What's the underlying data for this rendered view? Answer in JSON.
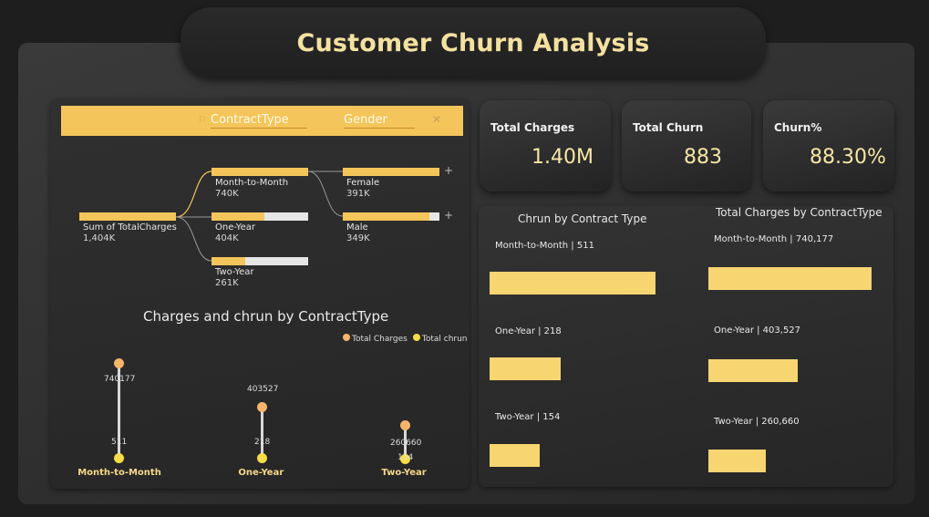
{
  "title": "Customer Churn Analysis",
  "colors": {
    "accent": "#f4c55a",
    "title": "#f4e1a0",
    "bar": "#f7d571",
    "charges_dot": "#f6b56b",
    "churn_dot": "#f7dd45"
  },
  "decomp_tree": {
    "header": {
      "level1": "ContractType",
      "level2": "Gender"
    },
    "root": {
      "label": "Sum of TotalCharges",
      "value": "1,404K"
    },
    "contract_nodes": [
      {
        "label": "Month-to-Month",
        "value": "740K",
        "fill": 1.0
      },
      {
        "label": "One-Year",
        "value": "404K",
        "fill": 0.545
      },
      {
        "label": "Two-Year",
        "value": "261K",
        "fill": 0.352
      }
    ],
    "gender_nodes": [
      {
        "label": "Female",
        "value": "391K",
        "fill": 1.0
      },
      {
        "label": "Male",
        "value": "349K",
        "fill": 0.892
      }
    ]
  },
  "lollipop": {
    "title": "Charges and chrun by ContractType",
    "legend": [
      "Total Charges",
      "Total chrun"
    ],
    "items": [
      {
        "category": "Month-to-Month",
        "charges_label": "740177",
        "churn_label": "511"
      },
      {
        "category": "One-Year",
        "charges_label": "403527",
        "churn_label": "218"
      },
      {
        "category": "Two-Year",
        "charges_label": "260660",
        "churn_label": "154"
      }
    ]
  },
  "kpis": [
    {
      "title": "Total Charges",
      "value": "1.40M"
    },
    {
      "title": "Total Churn",
      "value": "883"
    },
    {
      "title": "Churn%",
      "value": "88.30%"
    }
  ],
  "churn_by_contract": {
    "title": "Chrun by Contract Type",
    "items": [
      {
        "label": "Month-to-Month | 511",
        "value": 511
      },
      {
        "label": "One-Year | 218",
        "value": 218
      },
      {
        "label": "Two-Year | 154",
        "value": 154
      }
    ]
  },
  "charges_by_contract": {
    "title": "Total Charges by ContractType",
    "items": [
      {
        "label": "Month-to-Month | 740,177",
        "value": 740177
      },
      {
        "label": "One-Year | 403,527",
        "value": 403527
      },
      {
        "label": "Two-Year | 260,660",
        "value": 260660
      }
    ]
  },
  "chart_data": [
    {
      "type": "bar",
      "title": "Chrun by Contract Type",
      "categories": [
        "Month-to-Month",
        "One-Year",
        "Two-Year"
      ],
      "values": [
        511,
        218,
        154
      ]
    },
    {
      "type": "bar",
      "title": "Total Charges by ContractType",
      "categories": [
        "Month-to-Month",
        "One-Year",
        "Two-Year"
      ],
      "values": [
        740177,
        403527,
        260660
      ]
    },
    {
      "type": "scatter",
      "title": "Charges and chrun by ContractType",
      "categories": [
        "Month-to-Month",
        "One-Year",
        "Two-Year"
      ],
      "series": [
        {
          "name": "Total Charges",
          "values": [
            740177,
            403527,
            260660
          ]
        },
        {
          "name": "Total chrun",
          "values": [
            511,
            218,
            154
          ]
        }
      ]
    }
  ]
}
